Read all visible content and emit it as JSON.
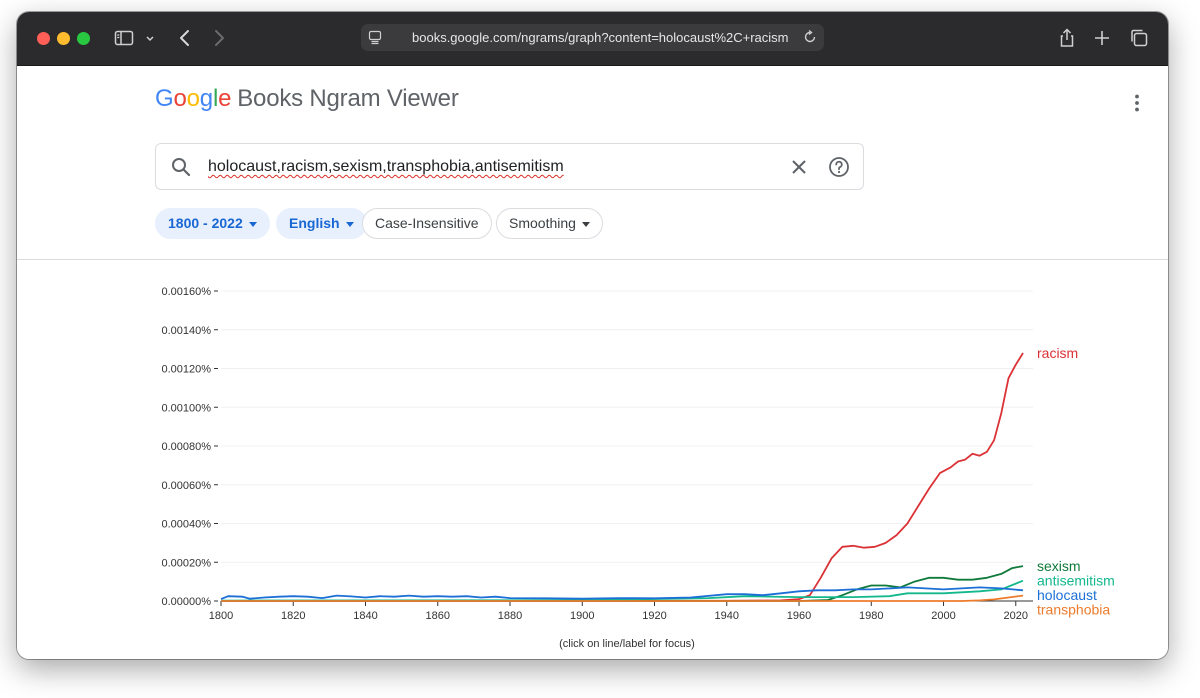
{
  "browser": {
    "url": "books.google.com/ngrams/graph?content=holocaust%2C+racism"
  },
  "app": {
    "logo_letters": [
      "G",
      "o",
      "o",
      "g",
      "l",
      "e"
    ],
    "product": "Books Ngram Viewer"
  },
  "search": {
    "query": "holocaust,racism,sexism,transphobia,antisemitism"
  },
  "filters": {
    "year_range": "1800 - 2022",
    "language": "English",
    "case": "Case-Insensitive",
    "smoothing": "Smoothing"
  },
  "icons": {
    "sidebar": "sidebar-toggle-icon",
    "back": "chevron-left-icon",
    "forward": "chevron-right-icon",
    "share": "share-icon",
    "new_tab": "plus-icon",
    "tabs": "tabs-overview-icon",
    "search": "search-icon",
    "clear": "close-icon",
    "help": "help-icon",
    "menu": "more-vert-icon"
  },
  "chart_data": {
    "type": "line",
    "xlabel": "",
    "ylabel": "",
    "xlim": [
      1800,
      2022
    ],
    "ylim": [
      0,
      0.0016
    ],
    "x_ticks": [
      1800,
      1820,
      1840,
      1860,
      1880,
      1900,
      1920,
      1940,
      1960,
      1980,
      2000,
      2020
    ],
    "y_ticks": [
      "0.00000%",
      "0.00020%",
      "0.00040%",
      "0.00060%",
      "0.00080%",
      "0.00100%",
      "0.00120%",
      "0.00140%",
      "0.00160%"
    ],
    "grid": true,
    "legend": "inline labels at line ends (right)",
    "footnote": "(click on line/label for focus)",
    "series": [
      {
        "name": "racism",
        "color": "#db3236",
        "points": [
          [
            1800,
            0
          ],
          [
            1900,
            0
          ],
          [
            1940,
            1e-06
          ],
          [
            1955,
            3e-06
          ],
          [
            1960,
            1e-05
          ],
          [
            1963,
            3e-05
          ],
          [
            1966,
            0.00012
          ],
          [
            1969,
            0.00022
          ],
          [
            1972,
            0.00028
          ],
          [
            1975,
            0.000285
          ],
          [
            1978,
            0.000275
          ],
          [
            1981,
            0.00028
          ],
          [
            1984,
            0.0003
          ],
          [
            1987,
            0.00034
          ],
          [
            1990,
            0.0004
          ],
          [
            1993,
            0.00049
          ],
          [
            1996,
            0.00058
          ],
          [
            1999,
            0.00066
          ],
          [
            2002,
            0.00069
          ],
          [
            2004,
            0.00072
          ],
          [
            2006,
            0.00073
          ],
          [
            2008,
            0.00076
          ],
          [
            2010,
            0.00075
          ],
          [
            2012,
            0.00077
          ],
          [
            2014,
            0.00083
          ],
          [
            2016,
            0.00097
          ],
          [
            2018,
            0.00115
          ],
          [
            2020,
            0.00122
          ],
          [
            2022,
            0.00128
          ]
        ]
      },
      {
        "name": "sexism",
        "color": "#0f7a3a",
        "points": [
          [
            1800,
            0
          ],
          [
            1960,
            0
          ],
          [
            1968,
            5e-06
          ],
          [
            1972,
            3e-05
          ],
          [
            1976,
            6e-05
          ],
          [
            1980,
            8e-05
          ],
          [
            1984,
            8e-05
          ],
          [
            1988,
            7e-05
          ],
          [
            1992,
            0.0001
          ],
          [
            1996,
            0.00012
          ],
          [
            2000,
            0.00012
          ],
          [
            2004,
            0.00011
          ],
          [
            2008,
            0.00011
          ],
          [
            2012,
            0.00012
          ],
          [
            2016,
            0.00014
          ],
          [
            2019,
            0.00017
          ],
          [
            2022,
            0.00018
          ]
        ]
      },
      {
        "name": "antisemitism",
        "color": "#13b88d",
        "points": [
          [
            1800,
            2e-06
          ],
          [
            1900,
            4e-06
          ],
          [
            1935,
            1.5e-05
          ],
          [
            1945,
            2.5e-05
          ],
          [
            1960,
            2e-05
          ],
          [
            1975,
            2e-05
          ],
          [
            1985,
            2.5e-05
          ],
          [
            1990,
            4e-05
          ],
          [
            2000,
            4e-05
          ],
          [
            2010,
            5e-05
          ],
          [
            2016,
            6e-05
          ],
          [
            2022,
            0.000105
          ]
        ]
      },
      {
        "name": "holocaust",
        "color": "#1c6fd6",
        "points": [
          [
            1800,
            1e-05
          ],
          [
            1802,
            2.5e-05
          ],
          [
            1806,
            2.2e-05
          ],
          [
            1808,
            1.2e-05
          ],
          [
            1812,
            1.8e-05
          ],
          [
            1816,
            2.2e-05
          ],
          [
            1820,
            2.5e-05
          ],
          [
            1824,
            2.2e-05
          ],
          [
            1828,
            1.5e-05
          ],
          [
            1832,
            2.8e-05
          ],
          [
            1836,
            2.4e-05
          ],
          [
            1840,
            1.8e-05
          ],
          [
            1844,
            2.5e-05
          ],
          [
            1848,
            2.2e-05
          ],
          [
            1852,
            2.8e-05
          ],
          [
            1856,
            2.2e-05
          ],
          [
            1860,
            2.5e-05
          ],
          [
            1864,
            2.2e-05
          ],
          [
            1868,
            2.5e-05
          ],
          [
            1872,
            1.8e-05
          ],
          [
            1876,
            2.2e-05
          ],
          [
            1880,
            1.5e-05
          ],
          [
            1890,
            1.4e-05
          ],
          [
            1900,
            1.2e-05
          ],
          [
            1910,
            1.5e-05
          ],
          [
            1920,
            1.4e-05
          ],
          [
            1930,
            1.8e-05
          ],
          [
            1940,
            3.5e-05
          ],
          [
            1945,
            3.5e-05
          ],
          [
            1950,
            3e-05
          ],
          [
            1955,
            4e-05
          ],
          [
            1960,
            5e-05
          ],
          [
            1965,
            5.5e-05
          ],
          [
            1970,
            5.5e-05
          ],
          [
            1975,
            6e-05
          ],
          [
            1980,
            6e-05
          ],
          [
            1990,
            7e-05
          ],
          [
            2000,
            6e-05
          ],
          [
            2010,
            7e-05
          ],
          [
            2016,
            6.5e-05
          ],
          [
            2022,
            5.5e-05
          ]
        ]
      },
      {
        "name": "transphobia",
        "color": "#ed7b2c",
        "points": [
          [
            1800,
            0
          ],
          [
            2005,
            0
          ],
          [
            2010,
            3e-06
          ],
          [
            2014,
            8e-06
          ],
          [
            2018,
            1.8e-05
          ],
          [
            2022,
            2.8e-05
          ]
        ]
      }
    ]
  }
}
